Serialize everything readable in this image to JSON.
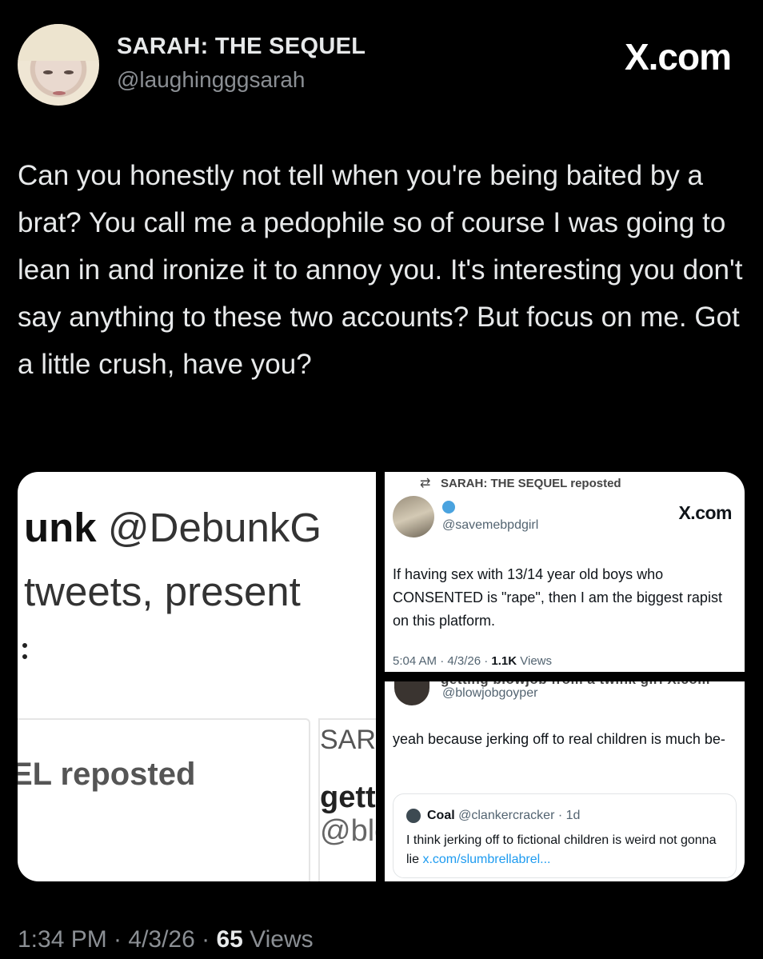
{
  "author": {
    "display_name": "SARAH: THE SEQUEL",
    "handle": "@laughingggsarah"
  },
  "brand": "X.com",
  "post": {
    "text": "Can you honestly not tell when you're being baited by a brat? You call me a pedophile so of course I was going to lean in and ironize it to annoy you. It's interesting you don't say anything to these two accounts? But focus on me. Got a little crush, have you?"
  },
  "left_image": {
    "line1_bold": "unk",
    "line1_rest": " @DebunkG",
    "line2": "tweets, present",
    "reposted": "EL reposted",
    "sara": "SARA",
    "getti": "getti",
    "bl": "@blo"
  },
  "repost_card": {
    "repost_label": "SARAH: THE SEQUEL reposted",
    "handle": "@savemebpdgirl",
    "brand": "X.com",
    "text": "If having sex with 13/14 year old boys who CONSENTED is \"rape\", then I am the biggest rapist on this platform.",
    "time": "5:04 AM · 4/3/26 · ",
    "views_count": "1.1K",
    "views_label": " Views"
  },
  "reply_card": {
    "cut_header": "getting blowjob from a twink girl  X.com",
    "handle": "@blowjobgoyper",
    "text": "yeah because jerking off to real children is much be-",
    "quote": {
      "name": "Coal",
      "handle_time": " @clankercracker · 1d",
      "text": "I think jerking off to fictional children is weird not gonna lie ",
      "link": "x.com/slumbrellabrel..."
    }
  },
  "footer": {
    "time": "1:34 PM · 4/3/26 · ",
    "views_count": "65",
    "views_label": " Views"
  }
}
